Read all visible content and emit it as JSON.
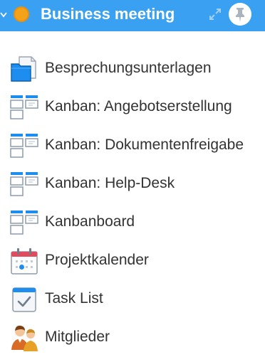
{
  "header": {
    "title": "Business meeting",
    "status_color": "#f3a21a",
    "background": "#3aa1f2"
  },
  "items": [
    {
      "label": "Besprechungsunterlagen",
      "icon": "folder-icon"
    },
    {
      "label": "Kanban: Angebotserstellung",
      "icon": "kanban-icon"
    },
    {
      "label": "Kanban: Dokumentenfreigabe",
      "icon": "kanban-icon"
    },
    {
      "label": "Kanban: Help-Desk",
      "icon": "kanban-icon"
    },
    {
      "label": "Kanbanboard",
      "icon": "kanban-icon"
    },
    {
      "label": "Projektkalender",
      "icon": "calendar-icon"
    },
    {
      "label": "Task List",
      "icon": "task-list-icon"
    },
    {
      "label": "Mitglieder",
      "icon": "members-icon"
    }
  ]
}
